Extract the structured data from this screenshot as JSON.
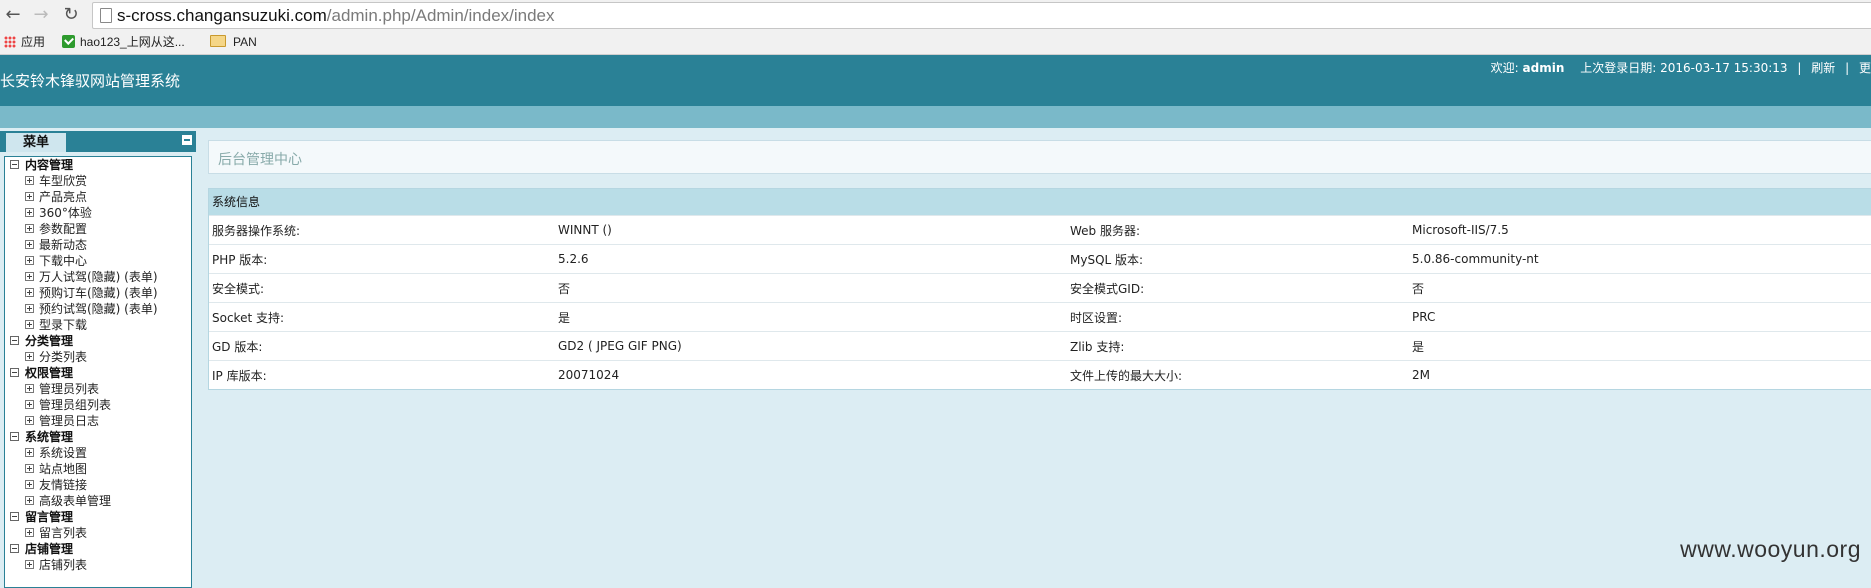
{
  "browser": {
    "url_host": "s-cross.changansuzuki.com",
    "url_path": "/admin.php/Admin/index/index",
    "bookmarks": [
      "应用",
      "hao123_上网从这...",
      "PAN"
    ]
  },
  "header": {
    "site_title": "长安铃木锋驭网站管理系统",
    "welcome_label": "欢迎:",
    "username": "admin",
    "last_login_label": "上次登录日期:",
    "last_login": "2016-03-17 15:30:13",
    "refresh": "刷新",
    "more": "更"
  },
  "sidebar": {
    "tab": "菜单",
    "groups": [
      {
        "title": "内容管理",
        "items": [
          "车型欣赏",
          "产品亮点",
          "360°体验",
          "参数配置",
          "最新动态",
          "下载中心",
          "万人试驾(隐藏) (表单)",
          "预购订车(隐藏) (表单)",
          "预约试驾(隐藏) (表单)",
          "型录下载"
        ]
      },
      {
        "title": "分类管理",
        "items": [
          "分类列表"
        ]
      },
      {
        "title": "权限管理",
        "items": [
          "管理员列表",
          "管理员组列表",
          "管理员日志"
        ]
      },
      {
        "title": "系统管理",
        "items": [
          "系统设置",
          "站点地图",
          "友情链接",
          "高级表单管理"
        ]
      },
      {
        "title": "留言管理",
        "items": [
          "留言列表"
        ]
      },
      {
        "title": "店铺管理",
        "items": [
          "店铺列表"
        ]
      }
    ]
  },
  "main": {
    "title": "后台管理中心",
    "sysinfo_title": "系统信息",
    "rows": [
      [
        "服务器操作系统:",
        "WINNT ()",
        "Web 服务器:",
        "Microsoft-IIS/7.5"
      ],
      [
        "PHP 版本:",
        "5.2.6",
        "MySQL 版本:",
        "5.0.86-community-nt"
      ],
      [
        "安全模式:",
        "否",
        "安全模式GID:",
        "否"
      ],
      [
        "Socket 支持:",
        "是",
        "时区设置:",
        "PRC"
      ],
      [
        "GD 版本:",
        "GD2 ( JPEG GIF PNG)",
        "Zlib 支持:",
        "是"
      ],
      [
        "IP 库版本:",
        "20071024",
        "文件上传的最大大小:",
        "2M"
      ]
    ]
  },
  "watermark": "www.wooyun.org"
}
